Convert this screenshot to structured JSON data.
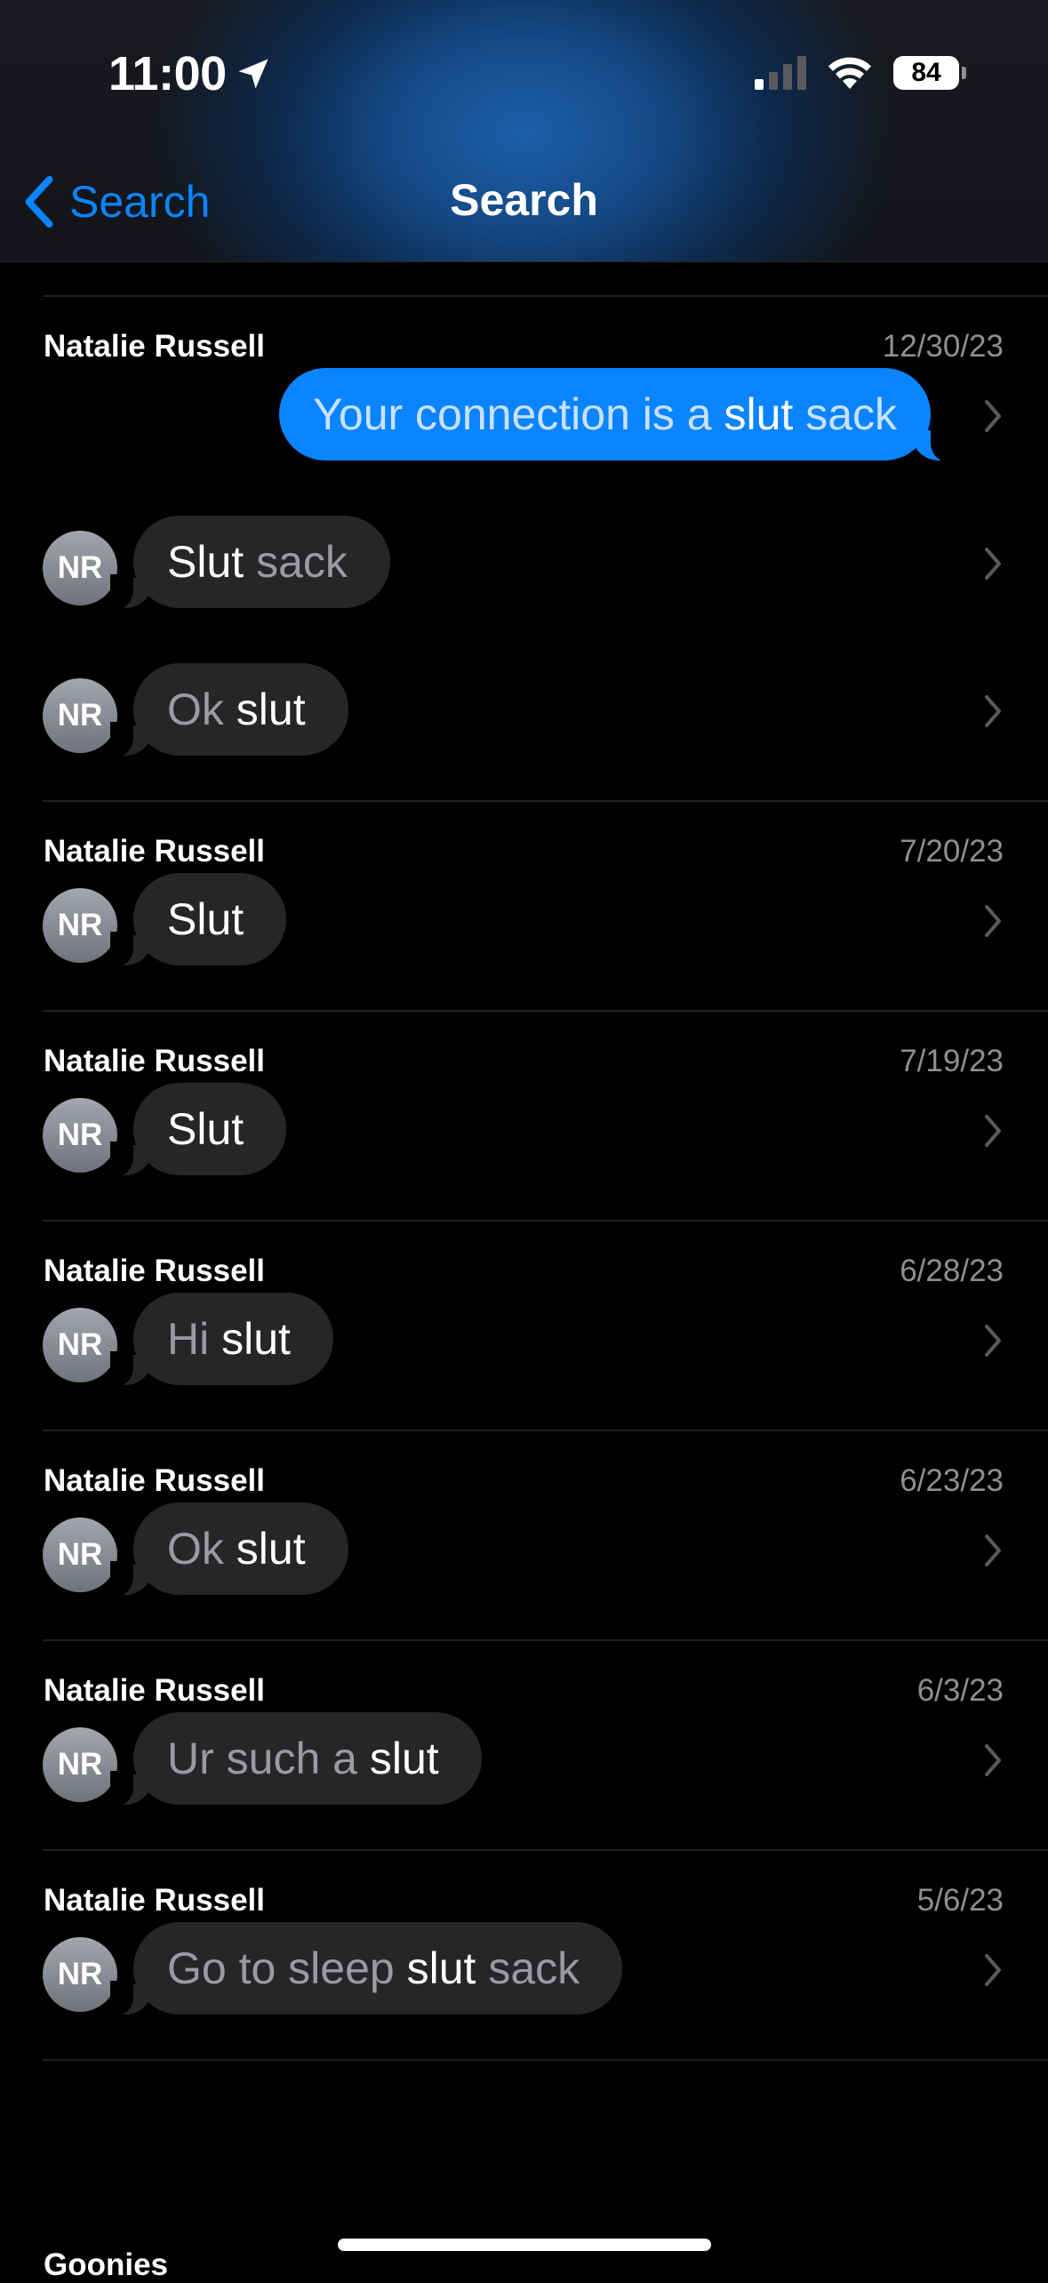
{
  "status_bar": {
    "time": "11:00",
    "battery": "84"
  },
  "nav": {
    "back_label": "Search",
    "title": "Search"
  },
  "groups": [
    {
      "name": "Natalie Russell",
      "date": "12/30/23",
      "messages": [
        {
          "direction": "out",
          "segments": [
            [
              "Your connection is a ",
              "dim"
            ],
            [
              "slut",
              "hl"
            ],
            [
              " sack",
              "dim"
            ]
          ]
        },
        {
          "direction": "in",
          "initials": "NR",
          "segments": [
            [
              "Slut",
              "hl"
            ],
            [
              " sack",
              "dim"
            ]
          ]
        },
        {
          "direction": "in",
          "initials": "NR",
          "segments": [
            [
              "Ok ",
              "dim"
            ],
            [
              "slut",
              "hl"
            ]
          ]
        }
      ]
    },
    {
      "name": "Natalie Russell",
      "date": "7/20/23",
      "messages": [
        {
          "direction": "in",
          "initials": "NR",
          "segments": [
            [
              "Slut",
              "hl"
            ]
          ]
        }
      ]
    },
    {
      "name": "Natalie Russell",
      "date": "7/19/23",
      "messages": [
        {
          "direction": "in",
          "initials": "NR",
          "segments": [
            [
              "Slut",
              "hl"
            ]
          ]
        }
      ]
    },
    {
      "name": "Natalie Russell",
      "date": "6/28/23",
      "messages": [
        {
          "direction": "in",
          "initials": "NR",
          "segments": [
            [
              "Hi ",
              "dim"
            ],
            [
              "slut",
              "hl"
            ]
          ]
        }
      ]
    },
    {
      "name": "Natalie Russell",
      "date": "6/23/23",
      "messages": [
        {
          "direction": "in",
          "initials": "NR",
          "segments": [
            [
              "Ok ",
              "dim"
            ],
            [
              "slut",
              "hl"
            ]
          ]
        }
      ]
    },
    {
      "name": "Natalie Russell",
      "date": "6/3/23",
      "messages": [
        {
          "direction": "in",
          "initials": "NR",
          "segments": [
            [
              "Ur such a ",
              "dim"
            ],
            [
              "slut",
              "hl"
            ]
          ]
        }
      ]
    },
    {
      "name": "Natalie Russell",
      "date": "5/6/23",
      "messages": [
        {
          "direction": "in",
          "initials": "NR",
          "segments": [
            [
              "Go to sleep ",
              "dim"
            ],
            [
              "slut",
              "hl"
            ],
            [
              " sack",
              "dim"
            ]
          ]
        }
      ]
    }
  ],
  "next_group_name": "Goonies"
}
